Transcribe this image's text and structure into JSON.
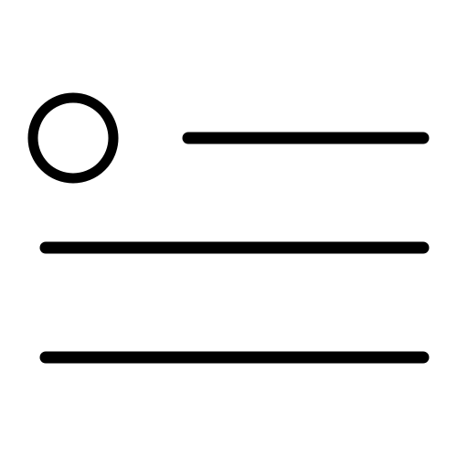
{
  "icon": {
    "name": "list-with-circle-icon",
    "stroke_color": "#000000",
    "background_color": "#ffffff",
    "parts": [
      "circle-bullet-icon",
      "line-1",
      "line-2",
      "line-3"
    ]
  }
}
